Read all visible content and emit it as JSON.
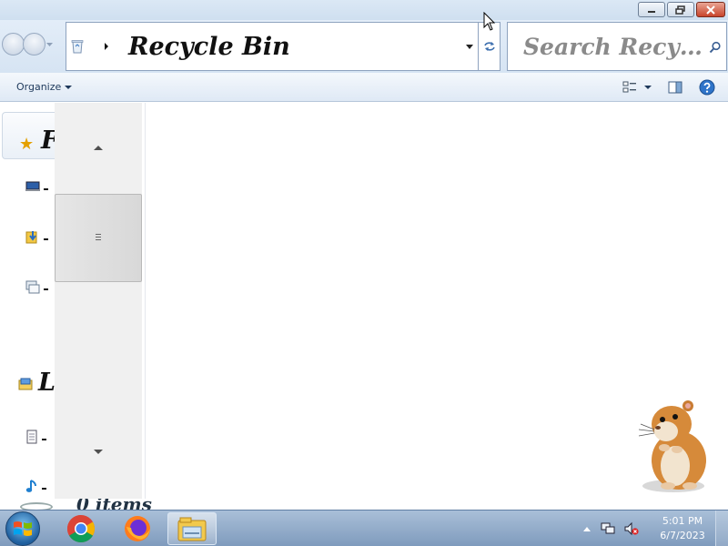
{
  "window": {
    "buttons": [
      "minimize",
      "maximize",
      "close"
    ]
  },
  "address_bar": {
    "location": "Recycle Bin",
    "icon": "recycle-bin-icon"
  },
  "search": {
    "placeholder": "Search Recy…"
  },
  "command_bar": {
    "organize_label": "Organize",
    "icons": [
      "change-view-icon",
      "preview-pane-icon",
      "help-icon"
    ]
  },
  "nav_pane": {
    "favorites_letter": "F",
    "libraries_letter": "L",
    "favorite_items": [
      "desktop-icon",
      "downloads-icon",
      "recent-places-icon"
    ],
    "library_items": [
      "documents-icon",
      "music-icon"
    ]
  },
  "details_pane": {
    "item_count": "0 items"
  },
  "taskbar": {
    "apps": [
      "chrome-icon",
      "firefox-icon",
      "windows-explorer-icon"
    ],
    "active_app": "windows-explorer-icon",
    "time": "5:01 PM",
    "date": "6/7/2023",
    "tray_icons": [
      "show-hidden-icons",
      "network-icon",
      "volume-muted-icon"
    ]
  },
  "colors": {
    "taskbar": "#8aa6c6",
    "nav_bg": "#dce8f5",
    "address_border": "#8ea3bf"
  }
}
